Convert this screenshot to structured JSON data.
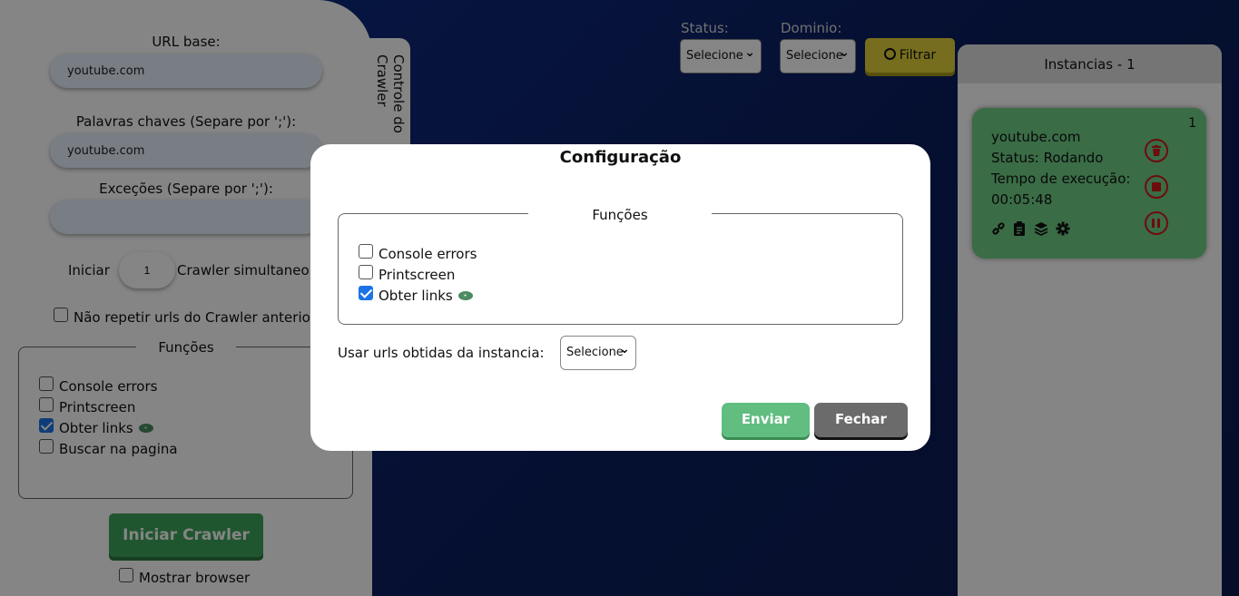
{
  "sidebar": {
    "tab_label": "Controle do Crawler",
    "url_base_label": "URL base:",
    "url_base_value": "youtube.com",
    "keywords_label": "Palavras chaves (Separe por ';'):",
    "keywords_value": "youtube.com",
    "exceptions_label": "Exceções (Separe por ';'):",
    "exceptions_value": "",
    "start_label": "Iniciar",
    "simultaneous_value": "1",
    "crawler_simultaneous_label": "Crawler simultaneo",
    "no_repeat_label": "Não repetir urls do Crawler anterior",
    "functions_legend": "Funções",
    "functions": [
      {
        "label": "Console errors",
        "checked": false
      },
      {
        "label": "Printscreen",
        "checked": false
      },
      {
        "label": "Obter links",
        "checked": true
      },
      {
        "label": "Buscar na pagina",
        "checked": false
      }
    ],
    "start_button": "Iniciar Crawler",
    "show_browser_label": "Mostrar browser"
  },
  "filters": {
    "status_label": "Status:",
    "status_selected": "Selecione",
    "domain_label": "Dominio:",
    "domain_selected": "Selecione",
    "filter_button": "Filtrar"
  },
  "instances": {
    "header": "Instancias - 1",
    "items": [
      {
        "number": "1",
        "domain": "youtube.com",
        "status": "Status: Rodando",
        "time_label": "Tempo de execução:",
        "time": "00:05:48",
        "icons": [
          "link-icon",
          "clipboard-icon",
          "layers-icon",
          "gear-icon"
        ],
        "actions": [
          "trash-icon",
          "stop-icon",
          "pause-icon"
        ]
      }
    ]
  },
  "modal": {
    "title": "Configuração",
    "functions_legend": "Funções",
    "functions": [
      {
        "label": "Console errors",
        "checked": false
      },
      {
        "label": "Printscreen",
        "checked": false
      },
      {
        "label": "Obter links",
        "checked": true
      }
    ],
    "use_urls_label": "Usar urls obtidas da instancia:",
    "use_urls_selected": "Selecione",
    "send_button": "Enviar",
    "close_button": "Fechar"
  },
  "colors": {
    "background": "#0d2f8c",
    "start_button": "#3fa65a",
    "filter_button": "#e3d33a",
    "instance_card": "#6fcf86",
    "danger": "#d21a1a",
    "send_button": "#62bd80",
    "close_button": "#6b6b6b"
  }
}
